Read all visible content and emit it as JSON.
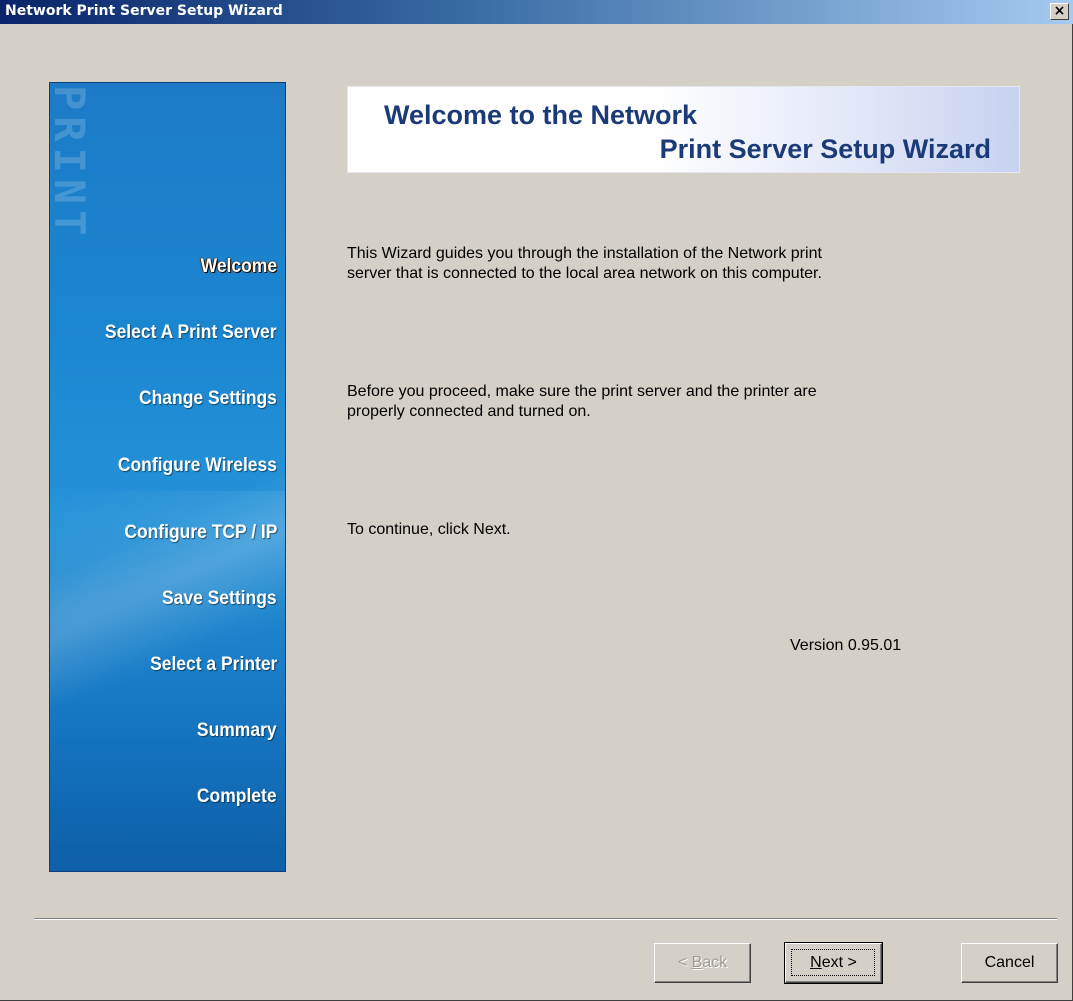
{
  "window": {
    "title": "Network Print Server Setup Wizard",
    "close_glyph": "×"
  },
  "sidebar": {
    "watermark": "PRINT",
    "steps": [
      {
        "label": "Welcome",
        "active": true
      },
      {
        "label": "Select A Print Server",
        "active": false
      },
      {
        "label": "Change Settings",
        "active": false
      },
      {
        "label": "Configure Wireless",
        "active": false
      },
      {
        "label": "Configure TCP / IP",
        "active": false
      },
      {
        "label": "Save Settings",
        "active": false
      },
      {
        "label": "Select a Printer",
        "active": false
      },
      {
        "label": "Summary",
        "active": false
      },
      {
        "label": "Complete",
        "active": false
      }
    ]
  },
  "banner": {
    "line1": "Welcome to the Network",
    "line2": "Print Server Setup Wizard"
  },
  "content": {
    "paragraph1_line1": "This Wizard guides you through the installation of the Network print",
    "paragraph1_line2": "server that is connected to the local area network on this computer.",
    "paragraph2_line1": "Before you proceed, make sure the print server and the printer are",
    "paragraph2_line2": "properly connected and turned on.",
    "paragraph3": "To continue, click Next.",
    "version": "Version 0.95.01"
  },
  "buttons": {
    "back_prefix": "< ",
    "back_accel": "B",
    "back_rest": "ack",
    "next_accel": "N",
    "next_rest": "ext >",
    "cancel": "Cancel"
  },
  "colors": {
    "titlebar_start": "#0a246a",
    "titlebar_end": "#a6caf0",
    "sidebar_blue": "#1b86d0",
    "banner_text": "#1a3a78",
    "dialog_face": "#d4d0c8"
  }
}
